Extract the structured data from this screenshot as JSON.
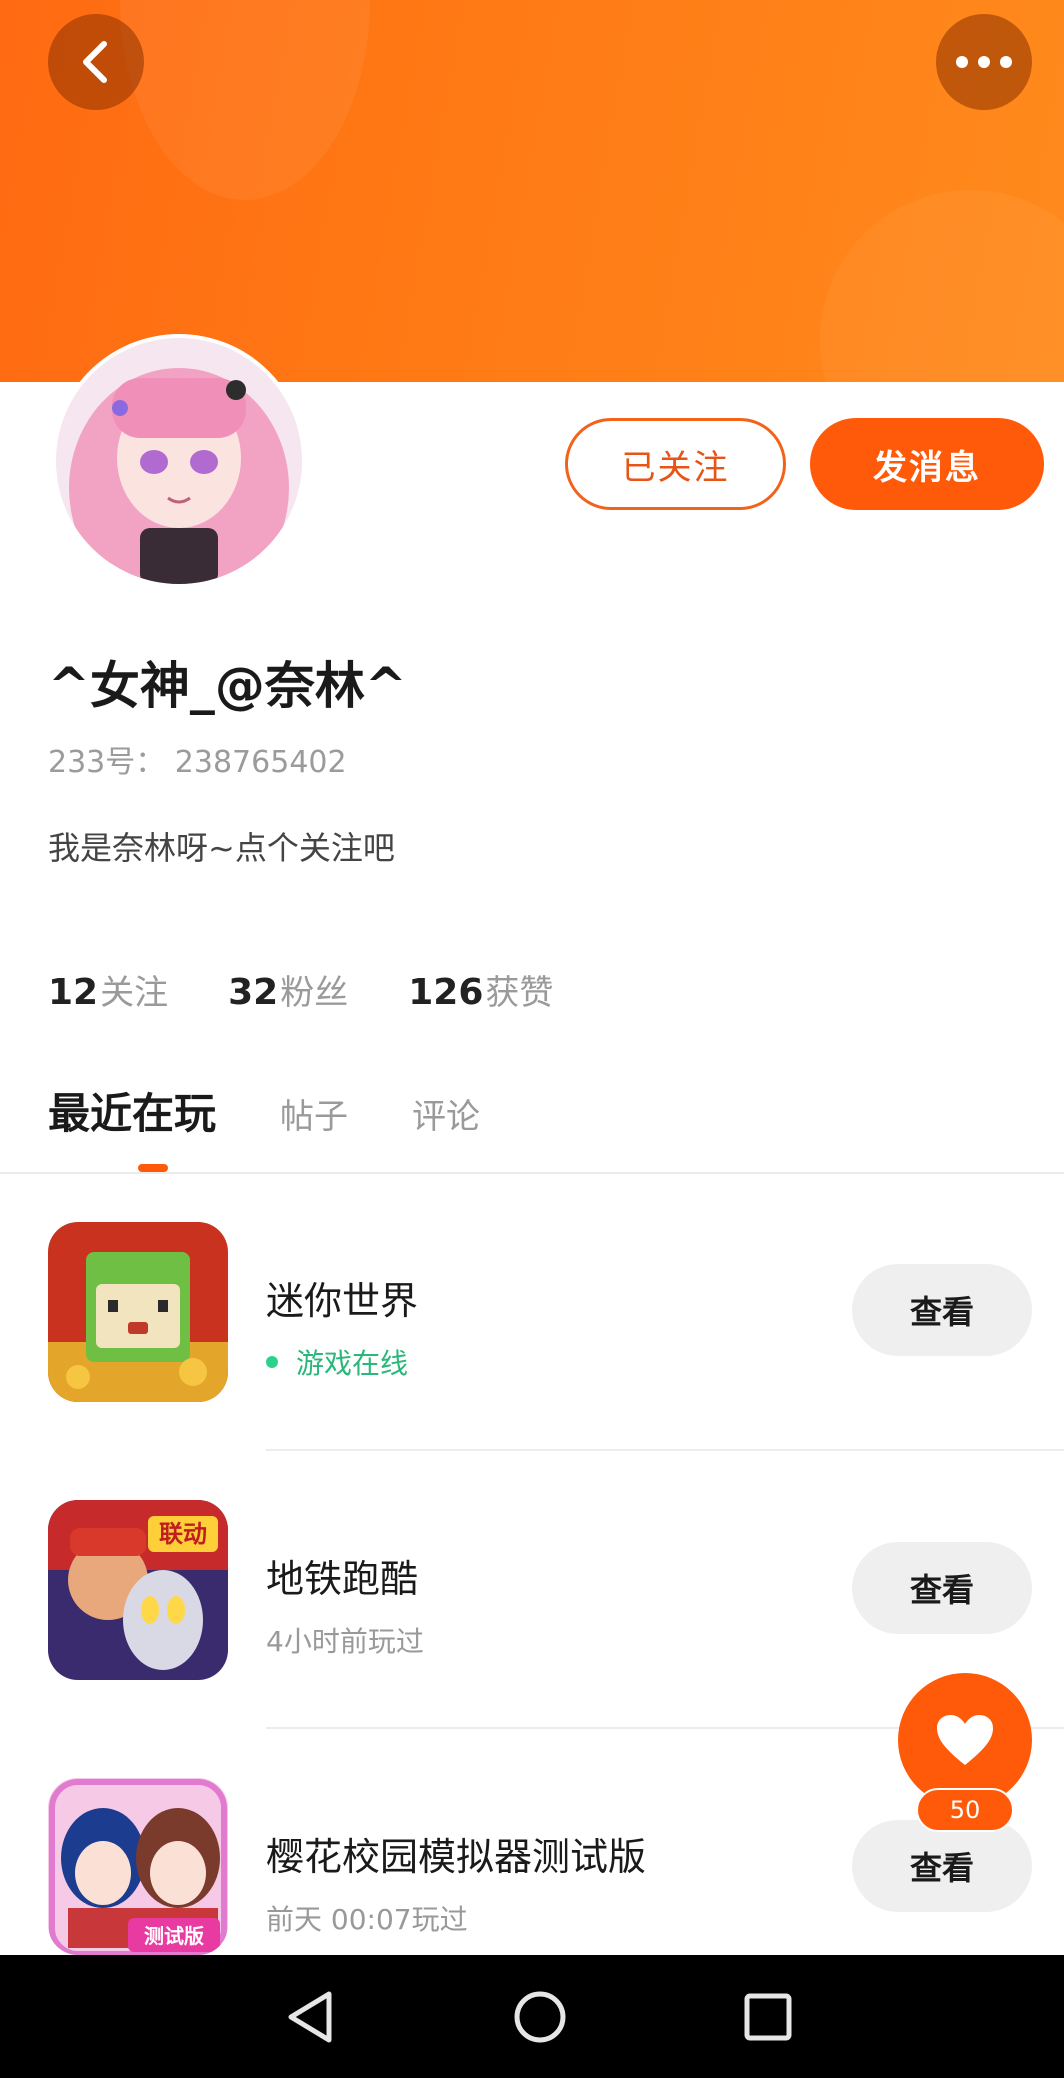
{
  "header": {
    "back_icon": "chevron-left-icon",
    "more_icon": "more-horizontal-icon",
    "banner_color": "#ff7a15"
  },
  "profile": {
    "nickname": "^女神_@奈林^",
    "user_id": "233号： 238765402",
    "bio": "我是奈林呀~点个关注吧",
    "follow_label": "已关注",
    "message_label": "发消息",
    "stats": [
      {
        "count": "12",
        "label": "关注"
      },
      {
        "count": "32",
        "label": "粉丝"
      },
      {
        "count": "126",
        "label": "获赞"
      }
    ]
  },
  "tabs": [
    {
      "label": "最近在玩",
      "active": true
    },
    {
      "label": "帖子",
      "active": false
    },
    {
      "label": "评论",
      "active": false
    }
  ],
  "games": [
    {
      "name": "迷你世界",
      "status": "游戏在线",
      "online": true,
      "button": "查看"
    },
    {
      "name": "地铁跑酷",
      "status": "4小时前玩过",
      "online": false,
      "button": "查看"
    },
    {
      "name": "樱花校园模拟器测试版",
      "status": "前天 00:07玩过",
      "online": false,
      "button": "查看"
    }
  ],
  "game_icon_badges": {
    "subway": "联动",
    "sakura": "测试版"
  },
  "like_fab": {
    "icon": "heart-icon",
    "count": "50"
  },
  "accent_color": "#ff5a0a",
  "online_color": "#2bb77a",
  "system_nav": {
    "back_icon": "triangle-back-icon",
    "home_icon": "circle-home-icon",
    "recents_icon": "square-recents-icon"
  }
}
